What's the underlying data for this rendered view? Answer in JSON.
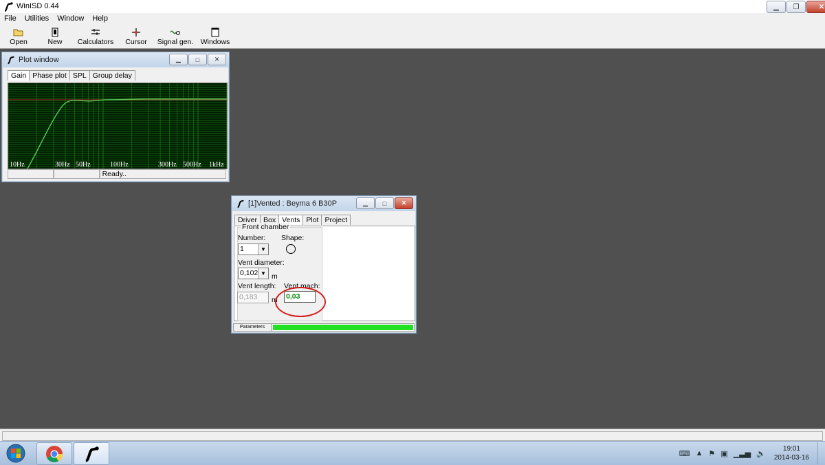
{
  "app": {
    "title": "WinISD 0.44"
  },
  "menu": [
    "File",
    "Utilities",
    "Window",
    "Help"
  ],
  "toolbar": [
    {
      "label": "Open",
      "icon": "folder-open-icon"
    },
    {
      "label": "New",
      "icon": "new-document-icon"
    },
    {
      "label": "Calculators",
      "icon": "calculator-icon"
    },
    {
      "label": "Cursor",
      "icon": "cursor-icon"
    },
    {
      "label": "Signal gen.",
      "icon": "signal-generator-icon"
    },
    {
      "label": "Windows",
      "icon": "windows-icon"
    }
  ],
  "plot_window": {
    "title": "Plot window",
    "tabs": [
      "Gain",
      "Phase plot",
      "SPL",
      "Group delay"
    ],
    "active_tab": "Gain",
    "x_ticks": [
      "10Hz",
      "30Hz",
      "50Hz",
      "100Hz",
      "300Hz",
      "500Hz",
      "1kHz"
    ],
    "status": "Ready.."
  },
  "project_window": {
    "title": "[1]Vented : Beyma 6 B30P",
    "tabs": [
      "Driver",
      "Box",
      "Vents",
      "Plot",
      "Project"
    ],
    "active_tab": "Vents",
    "group_label": "Front chamber",
    "number_label": "Number:",
    "number_value": "1",
    "shape_label": "Shape:",
    "vent_diameter_label": "Vent diameter:",
    "vent_diameter_value": "0,102",
    "vent_diameter_unit": "m",
    "vent_length_label": "Vent length:",
    "vent_length_value": "0,183",
    "vent_length_unit": "m",
    "vent_mach_label": "Vent mach:",
    "vent_mach_value": "0,03",
    "bottom_tab": "Parameters"
  },
  "taskbar": {
    "clock_time": "19:01",
    "clock_date": "2014-03-16"
  }
}
